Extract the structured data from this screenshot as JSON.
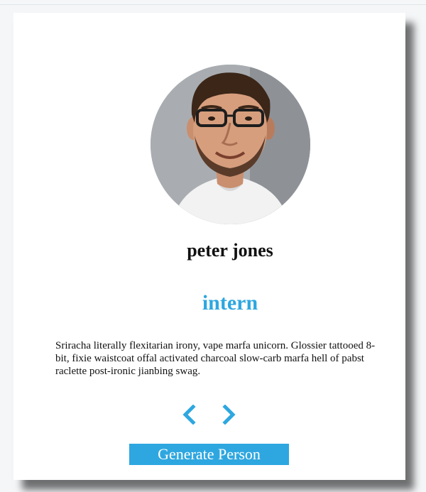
{
  "person": {
    "name": "peter jones",
    "job": "intern",
    "info": "Sriracha literally flexitarian irony, vape marfa unicorn. Glossier tattooed 8-bit, fixie waistcoat offal activated charcoal slow-carb marfa hell of pabst raclette post-ironic jianbing swag."
  },
  "controls": {
    "prev_icon": "chevron-left-icon",
    "next_icon": "chevron-right-icon",
    "random_label": "Generate Person"
  },
  "colors": {
    "accent": "#2ea7e0",
    "card": "#ffffff",
    "page": "#f4f6f8"
  }
}
